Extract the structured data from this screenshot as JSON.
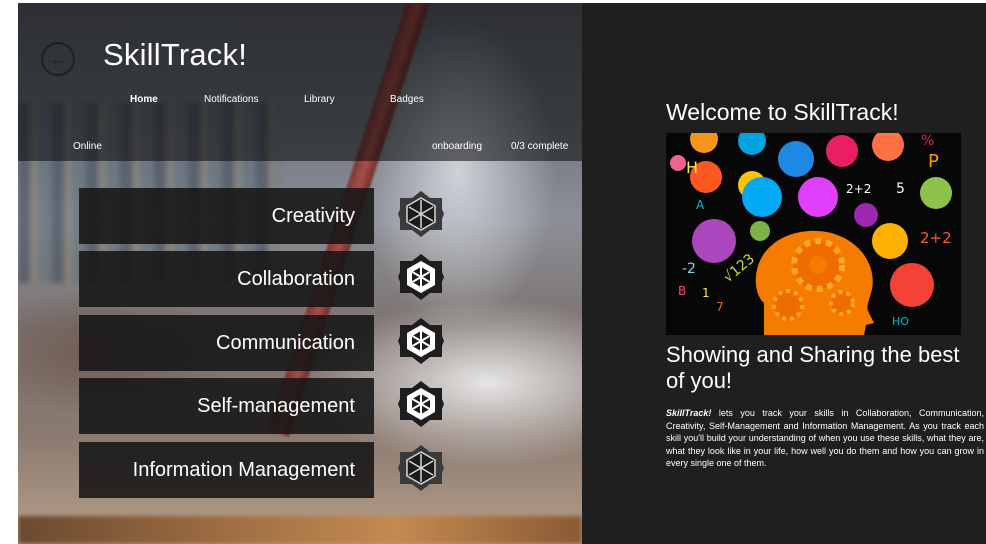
{
  "app": {
    "title": "SkillTrack!"
  },
  "nav": {
    "items": [
      {
        "label": "Home",
        "active": true
      },
      {
        "label": "Notifications",
        "active": false
      },
      {
        "label": "Library",
        "active": false
      },
      {
        "label": "Badges",
        "active": false
      }
    ]
  },
  "status": {
    "online": "Online",
    "onboarding": "onboarding",
    "progress": "0/3 complete"
  },
  "skills": [
    {
      "label": "Creativity",
      "badge_icon": "hexagon-flower-badge-icon"
    },
    {
      "label": "Collaboration",
      "badge_icon": "hexagon-flower-badge-icon"
    },
    {
      "label": "Communication",
      "badge_icon": "hexagon-flower-badge-icon"
    },
    {
      "label": "Self-management",
      "badge_icon": "hexagon-flower-badge-icon"
    },
    {
      "label": "Information Management",
      "badge_icon": "hexagon-flower-badge-icon"
    }
  ],
  "welcome": {
    "title": "Welcome to SkillTrack!",
    "subtitle": "Showing and Sharing the best of you!",
    "description_brand": "SkillTrack!",
    "description_text": " lets you track your skills in Collaboration, Communication, Creativity, Self-Management and Information Management. As you track each skill you'll build your understanding of when you use these skills, what they are, what they look like in your life, how well you do them and how you can grow in every single one of them."
  },
  "hero": {
    "symbols": [
      "H",
      "%",
      "P",
      "2+2",
      "A",
      "√123",
      "-2",
      "B",
      "1",
      "7",
      "HO",
      "2+2",
      "5"
    ]
  },
  "colors": {
    "right_panel_bg": "#1f1f1f",
    "tile_bg": "#161616",
    "text": "#ffffff"
  }
}
